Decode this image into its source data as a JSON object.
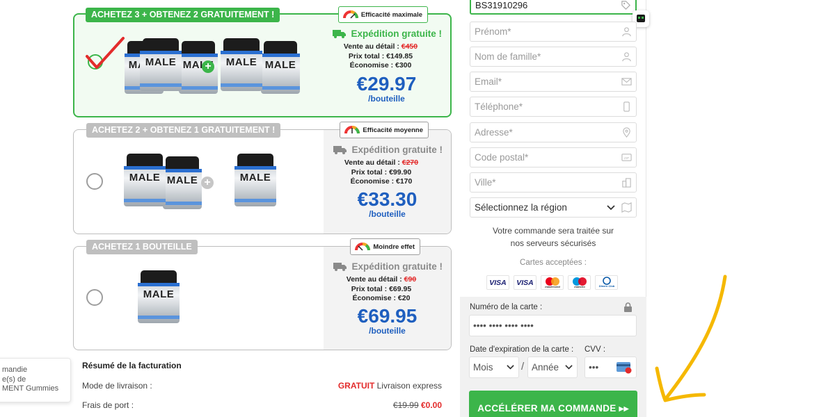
{
  "offers": [
    {
      "ribbon": "ACHETEZ 3 + OBTENEZ 2 GRATUITEMENT !",
      "efficacy": "Efficacité maximale",
      "shipping": "Expédition gratuite !",
      "retail_label": "Vente au détail :",
      "retail_price": "€450",
      "total_label": "Prix total :",
      "total": "€149.85",
      "savings_label": "Économise :",
      "savings": "€300",
      "price": "€29.97",
      "per": "/bouteille",
      "selected": true
    },
    {
      "ribbon": "ACHETEZ 2 + OBTENEZ 1 GRATUITEMENT !",
      "efficacy": "Efficacité moyenne",
      "shipping": "Expédition gratuite !",
      "retail_label": "Vente au détail :",
      "retail_price": "€270",
      "total_label": "Prix total :",
      "total": "€99.90",
      "savings_label": "Économise :",
      "savings": "€170",
      "price": "€33.30",
      "per": "/bouteille",
      "selected": false
    },
    {
      "ribbon": "ACHETEZ 1 BOUTEILLE",
      "efficacy": "Moindre effet",
      "shipping": "Expédition gratuite !",
      "retail_label": "Vente au détail :",
      "retail_price": "€90",
      "total_label": "Prix total :",
      "total": "€69.95",
      "savings_label": "Économise :",
      "savings": "€20",
      "price": "€69.95",
      "per": "/bouteille",
      "selected": false
    }
  ],
  "product_word": "MALE",
  "summary": {
    "title": "Résumé de la facturation",
    "delivery_label": "Mode de livraison :",
    "delivery_free": "GRATUIT",
    "delivery_value": "Livraison express",
    "shipping_label": "Frais de port :",
    "shipping_old": "€19.99",
    "shipping_new": "€0.00"
  },
  "popup": {
    "line1": "mandie",
    "line2": "e(s) de",
    "line3": "MENT Gummies"
  },
  "form": {
    "code_value": "BS31910296",
    "first_name": "Prénom*",
    "last_name": "Nom de famille*",
    "email": "Email*",
    "phone": "Téléphone*",
    "address": "Adresse*",
    "postal": "Code postal*",
    "city": "Ville*",
    "region": "Sélectionnez la région",
    "secure_line1": "Votre commande sera traitée sur",
    "secure_line2": "nos serveurs sécurisés",
    "accepted_cards": "Cartes acceptées :",
    "cards": [
      "VISA",
      "VISA",
      "mastercard",
      "maestro",
      "Diners Club"
    ],
    "card_number_label": "Numéro de la carte :",
    "card_number_placeholder": "•••• •••• •••• ••••",
    "expiry_label": "Date d'expiration de la carte :",
    "cvv_label": "CVV :",
    "month": "Mois",
    "year": "Année",
    "slash": "/",
    "cvv_placeholder": "•••",
    "cta": "ACCÉLÉRER MA COMMANDE ▸▸"
  },
  "colors": {
    "green": "#3cb54a",
    "blue_price": "#1f5fbf",
    "red": "#e32b2b",
    "arrow": "#f5b800"
  }
}
